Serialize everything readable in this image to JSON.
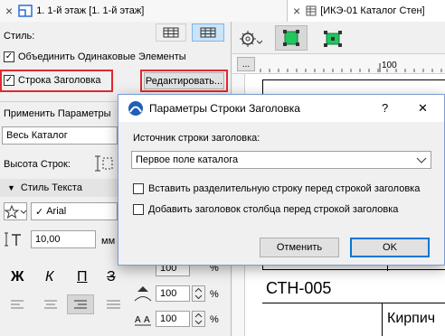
{
  "tabs": {
    "tab1_title": "1. 1-й этаж [1. 1-й этаж]",
    "tab2_title": "[ИКЭ-01 Каталог Стен]",
    "close": "×"
  },
  "panel": {
    "style_label": "Стиль:",
    "merge_label": "Объединить Одинаковые Элементы",
    "header_row_label": "Строка Заголовка",
    "edit_button": "Редактировать...",
    "apply_params_label": "Применить Параметры",
    "apply_value": "Весь Каталог",
    "row_height_label": "Высота Строк:",
    "text_style_header": "Стиль Текста",
    "font_value": "Arial",
    "font_size_value": "10,00",
    "font_size_unit": "мм",
    "bold": "Ж",
    "italic": "К",
    "underline": "П",
    "strike": "З",
    "pct1": "100",
    "pct2": "100",
    "pct3": "100",
    "pct_unit": "%"
  },
  "doc": {
    "ruler_label": "100",
    "ruler_btn": "...",
    "cell1": "СТН-005",
    "cell2": "Кирпич"
  },
  "dialog": {
    "title": "Параметры Строки Заголовка",
    "help": "?",
    "close": "✕",
    "source_label": "Источник строки заголовка:",
    "source_value": "Первое поле каталога",
    "opt1": "Вставить разделительную строку перед строкой заголовка",
    "opt2": "Добавить заголовок столбца перед строкой заголовка",
    "cancel": "Отменить",
    "ok": "OK"
  },
  "colors": {
    "highlight": "#e0282e",
    "accent": "#0078d7",
    "green": "#22c55e"
  }
}
